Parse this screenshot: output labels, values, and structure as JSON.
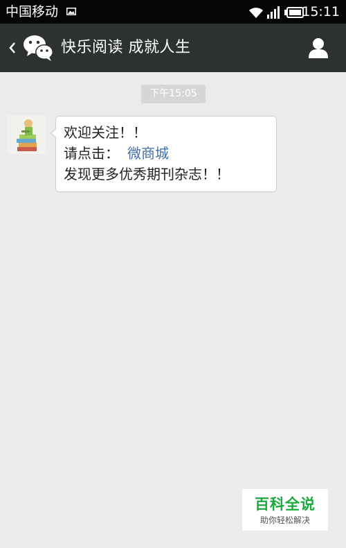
{
  "status_bar": {
    "carrier": "中国移动",
    "time": "15:11",
    "icons": [
      "gallery-icon",
      "wifi-icon",
      "signal-icon",
      "battery-icon"
    ]
  },
  "header": {
    "title": "快乐阅读 成就人生",
    "icons": [
      "back-icon",
      "wechat-icon",
      "profile-icon"
    ]
  },
  "chat": {
    "timestamp": "下午15:05",
    "message": {
      "line1": "欢迎关注！！",
      "line2_prefix": "请点击：",
      "line2_link": "微商城",
      "line3": "发现更多优秀期刊杂志！！"
    }
  },
  "watermark": {
    "title": "百科全说",
    "subtitle": "助你轻松解决"
  },
  "colors": {
    "header_bg": "#2d3132",
    "chat_bg": "#ebebeb",
    "link": "#3f6ea8",
    "watermark_green": "#1aaa3c"
  }
}
